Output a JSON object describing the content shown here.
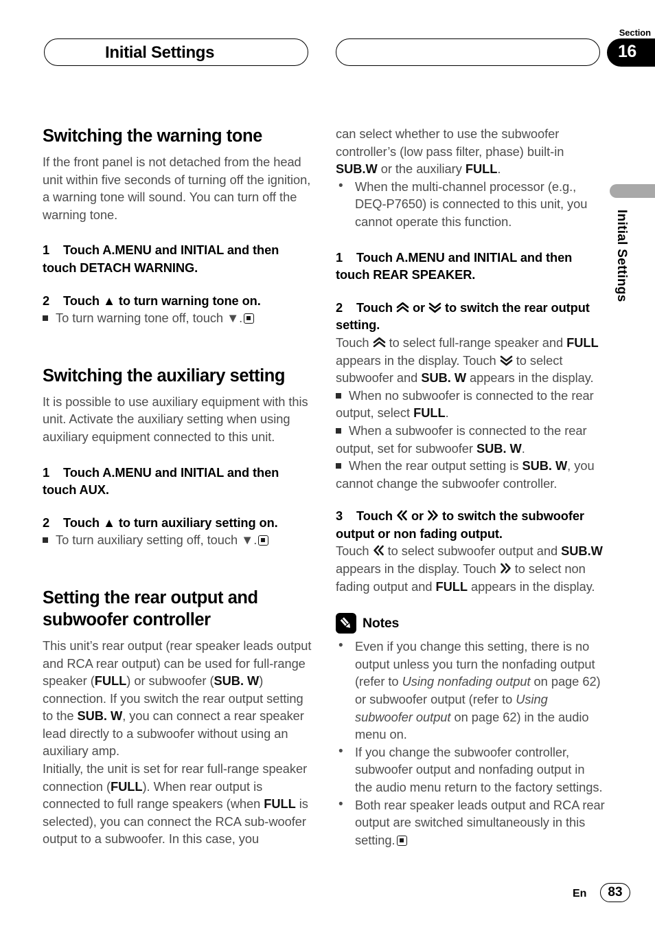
{
  "header": {
    "title": "Initial Settings",
    "section_label": "Section",
    "section_number": "16",
    "right_pill_text": ""
  },
  "side_tab": {
    "label": "Initial Settings"
  },
  "footer": {
    "language": "En",
    "page_number": "83"
  },
  "left_column": {
    "section1": {
      "heading": "Switching the warning tone",
      "intro": "If the front panel is not detached from the head unit within five seconds of turning off the ignition, a warning tone will sound. You can turn off the warning tone.",
      "step1_num": "1",
      "step1_text": "Touch A.MENU and INITIAL and then touch DETACH WARNING.",
      "step2_num": "2",
      "step2_text": "Touch ▲ to turn warning tone on.",
      "step2_note": "To turn warning tone off, touch ▼."
    },
    "section2": {
      "heading": "Switching the auxiliary setting",
      "intro": "It is possible to use auxiliary equipment with this unit. Activate the auxiliary setting when using auxiliary equipment connected to this unit.",
      "step1_num": "1",
      "step1_text": "Touch A.MENU and INITIAL and then touch AUX.",
      "step2_num": "2",
      "step2_text": "Touch ▲ to turn auxiliary setting on.",
      "step2_note": "To turn auxiliary setting off, touch ▼."
    },
    "section3": {
      "heading": "Setting the rear output and subwoofer controller",
      "para1_a": "This unit’s rear output (rear speaker leads output and RCA rear output) can be used for full-range speaker (",
      "para1_b": "FULL",
      "para1_c": ") or subwoofer (",
      "para1_d": "SUB. W",
      "para1_e": ") connection. If you switch the rear output setting to the ",
      "para1_f": "SUB. W",
      "para1_g": ", you can connect a rear speaker lead directly to a subwoofer without using an auxiliary amp.",
      "para2_a": "Initially, the unit is set for rear full-range speaker connection (",
      "para2_b": "FULL",
      "para2_c": "). When rear output is connected to full range speakers (when ",
      "para2_d": "FULL",
      "para2_e": " is selected), you can connect the RCA sub-woofer output to a subwoofer. In this case, you"
    }
  },
  "right_column": {
    "continuation": {
      "text_a": "can select whether to use the subwoofer controller’s (low pass filter, phase) built-in ",
      "text_b": "SUB.W",
      "text_c": " or the auxiliary ",
      "text_d": "FULL",
      "text_e": ".",
      "bullet1": "When the multi-channel processor (e.g., DEQ-P7650) is connected to this unit, you cannot operate this function."
    },
    "step1_num": "1",
    "step1_text": "Touch A.MENU and INITIAL and then touch REAR SPEAKER.",
    "step2_num": "2",
    "step2_pre": "Touch ",
    "step2_or": " or ",
    "step2_post": " to switch the rear output setting.",
    "step2_body_a": "Touch ",
    "step2_body_b": " to select full-range speaker and ",
    "step2_body_c": "FULL",
    "step2_body_d": " appears in the display. Touch ",
    "step2_body_e": " to select subwoofer and ",
    "step2_body_f": "SUB. W",
    "step2_body_g": " appears in the display.",
    "step2_notes": [
      {
        "a": "When no subwoofer is connected to the rear output, select ",
        "b": "FULL",
        "c": "."
      },
      {
        "a": "When a subwoofer is connected to the rear output, set for subwoofer ",
        "b": "SUB. W",
        "c": "."
      },
      {
        "a": "When the rear output setting is ",
        "b": "SUB. W",
        "c": ", you cannot change the subwoofer controller."
      }
    ],
    "step3_num": "3",
    "step3_pre": "Touch ",
    "step3_or": " or ",
    "step3_post": " to switch the subwoofer output or non fading output.",
    "step3_body_a": "Touch ",
    "step3_body_b": " to select subwoofer output and ",
    "step3_body_c": "SUB.W",
    "step3_body_d": " appears in the display. Touch ",
    "step3_body_e": " to select non fading output and ",
    "step3_body_f": "FULL",
    "step3_body_g": " appears in the display.",
    "notes_title": "Notes",
    "notes": [
      {
        "a": "Even if you change this setting, there is no output unless you turn the nonfading output (refer to ",
        "i1": "Using nonfading output",
        "b": " on page 62) or subwoofer output (refer to ",
        "i2": "Using subwoofer output",
        "c": " on page 62) in the audio menu on."
      },
      {
        "a": "If you change the subwoofer controller, subwoofer output and nonfading output in the audio menu return to the factory settings.",
        "i1": "",
        "b": "",
        "i2": "",
        "c": ""
      },
      {
        "a": "Both rear speaker leads output and RCA rear output are switched simultaneously in this setting.",
        "i1": "",
        "b": "",
        "i2": "",
        "c": ""
      }
    ]
  },
  "icons": {
    "notes_icon": "pencil-icon",
    "chevron_up": "double-chevron-up-icon",
    "chevron_down": "double-chevron-down-icon",
    "angle_left": "double-angle-left-icon",
    "angle_right": "double-angle-right-icon",
    "terminator": "end-of-section-icon"
  },
  "colors": {
    "text_body": "#4d4d4d",
    "text_bold": "#111111",
    "accent_black": "#000000",
    "tab_gray": "#a8a8a8"
  }
}
